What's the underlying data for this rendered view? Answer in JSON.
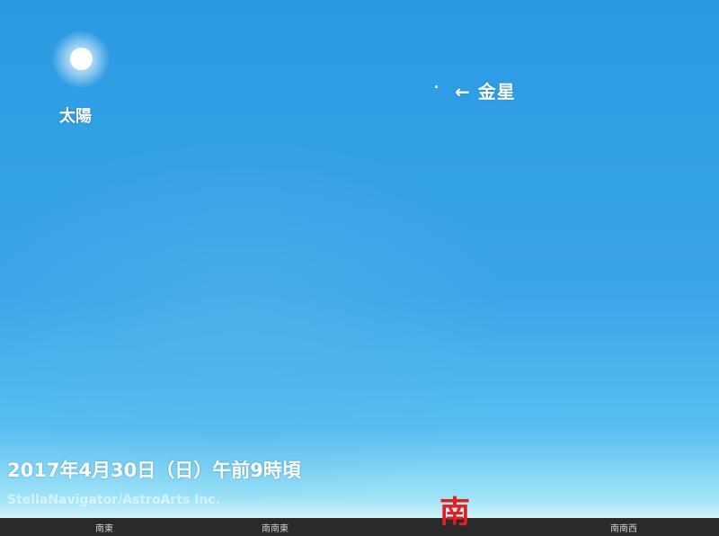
{
  "sun": {
    "label": "太陽",
    "icon": "sun-icon"
  },
  "venus": {
    "label": "← 金星",
    "icon": "venus-dot-icon"
  },
  "datetime": "2017年4月30日（日）午前9時頃",
  "credit": "StellaNavigator/AstroArts Inc.",
  "directions": {
    "southeast": "南東",
    "south_southeast": "南南東",
    "south": "南",
    "south_southwest": "南南西"
  },
  "colors": {
    "sky_top": "#2b9ae2",
    "horizon_glow": "#d6f7fb",
    "south_marker": "#e02020",
    "ground": "#2a2a2a"
  }
}
